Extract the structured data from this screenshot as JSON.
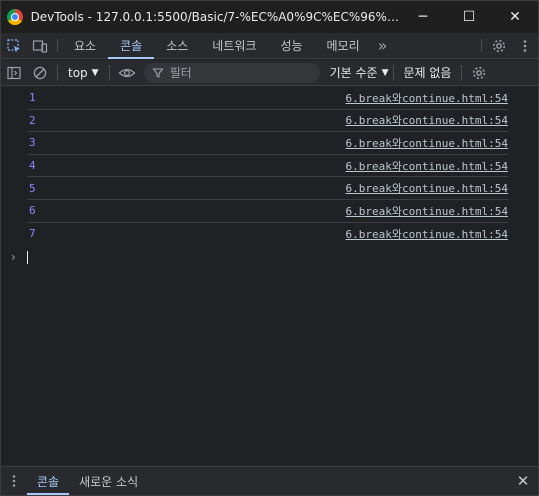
{
  "window": {
    "title": "DevTools - 127.0.0.1:5500/Basic/7-%EC%A0%9C%EC%96%B4%EB%...",
    "controls": {
      "minimize": "─",
      "maximize": "☐",
      "close": "✕"
    }
  },
  "tabs": [
    {
      "label": "요소",
      "active": false
    },
    {
      "label": "콘솔",
      "active": true
    },
    {
      "label": "소스",
      "active": false
    },
    {
      "label": "네트워크",
      "active": false
    },
    {
      "label": "성능",
      "active": false
    },
    {
      "label": "메모리",
      "active": false
    }
  ],
  "tabs_more": "»",
  "toolbar": {
    "context": "top",
    "filter_placeholder": "필터",
    "levels": "기본 수준",
    "issues": "문제 없음"
  },
  "console": {
    "logs": [
      {
        "value": "1",
        "source": "6.break와continue.html:54"
      },
      {
        "value": "2",
        "source": "6.break와continue.html:54"
      },
      {
        "value": "3",
        "source": "6.break와continue.html:54"
      },
      {
        "value": "4",
        "source": "6.break와continue.html:54"
      },
      {
        "value": "5",
        "source": "6.break와continue.html:54"
      },
      {
        "value": "6",
        "source": "6.break와continue.html:54"
      },
      {
        "value": "7",
        "source": "6.break와continue.html:54"
      }
    ],
    "prompt": "›"
  },
  "drawer": {
    "tabs": [
      {
        "label": "콘솔",
        "active": true
      },
      {
        "label": "새로운 소식",
        "active": false
      }
    ],
    "close": "✕"
  },
  "colors": {
    "accent": "#a8c7fa",
    "log_value": "#9980ff",
    "background": "#202124"
  }
}
